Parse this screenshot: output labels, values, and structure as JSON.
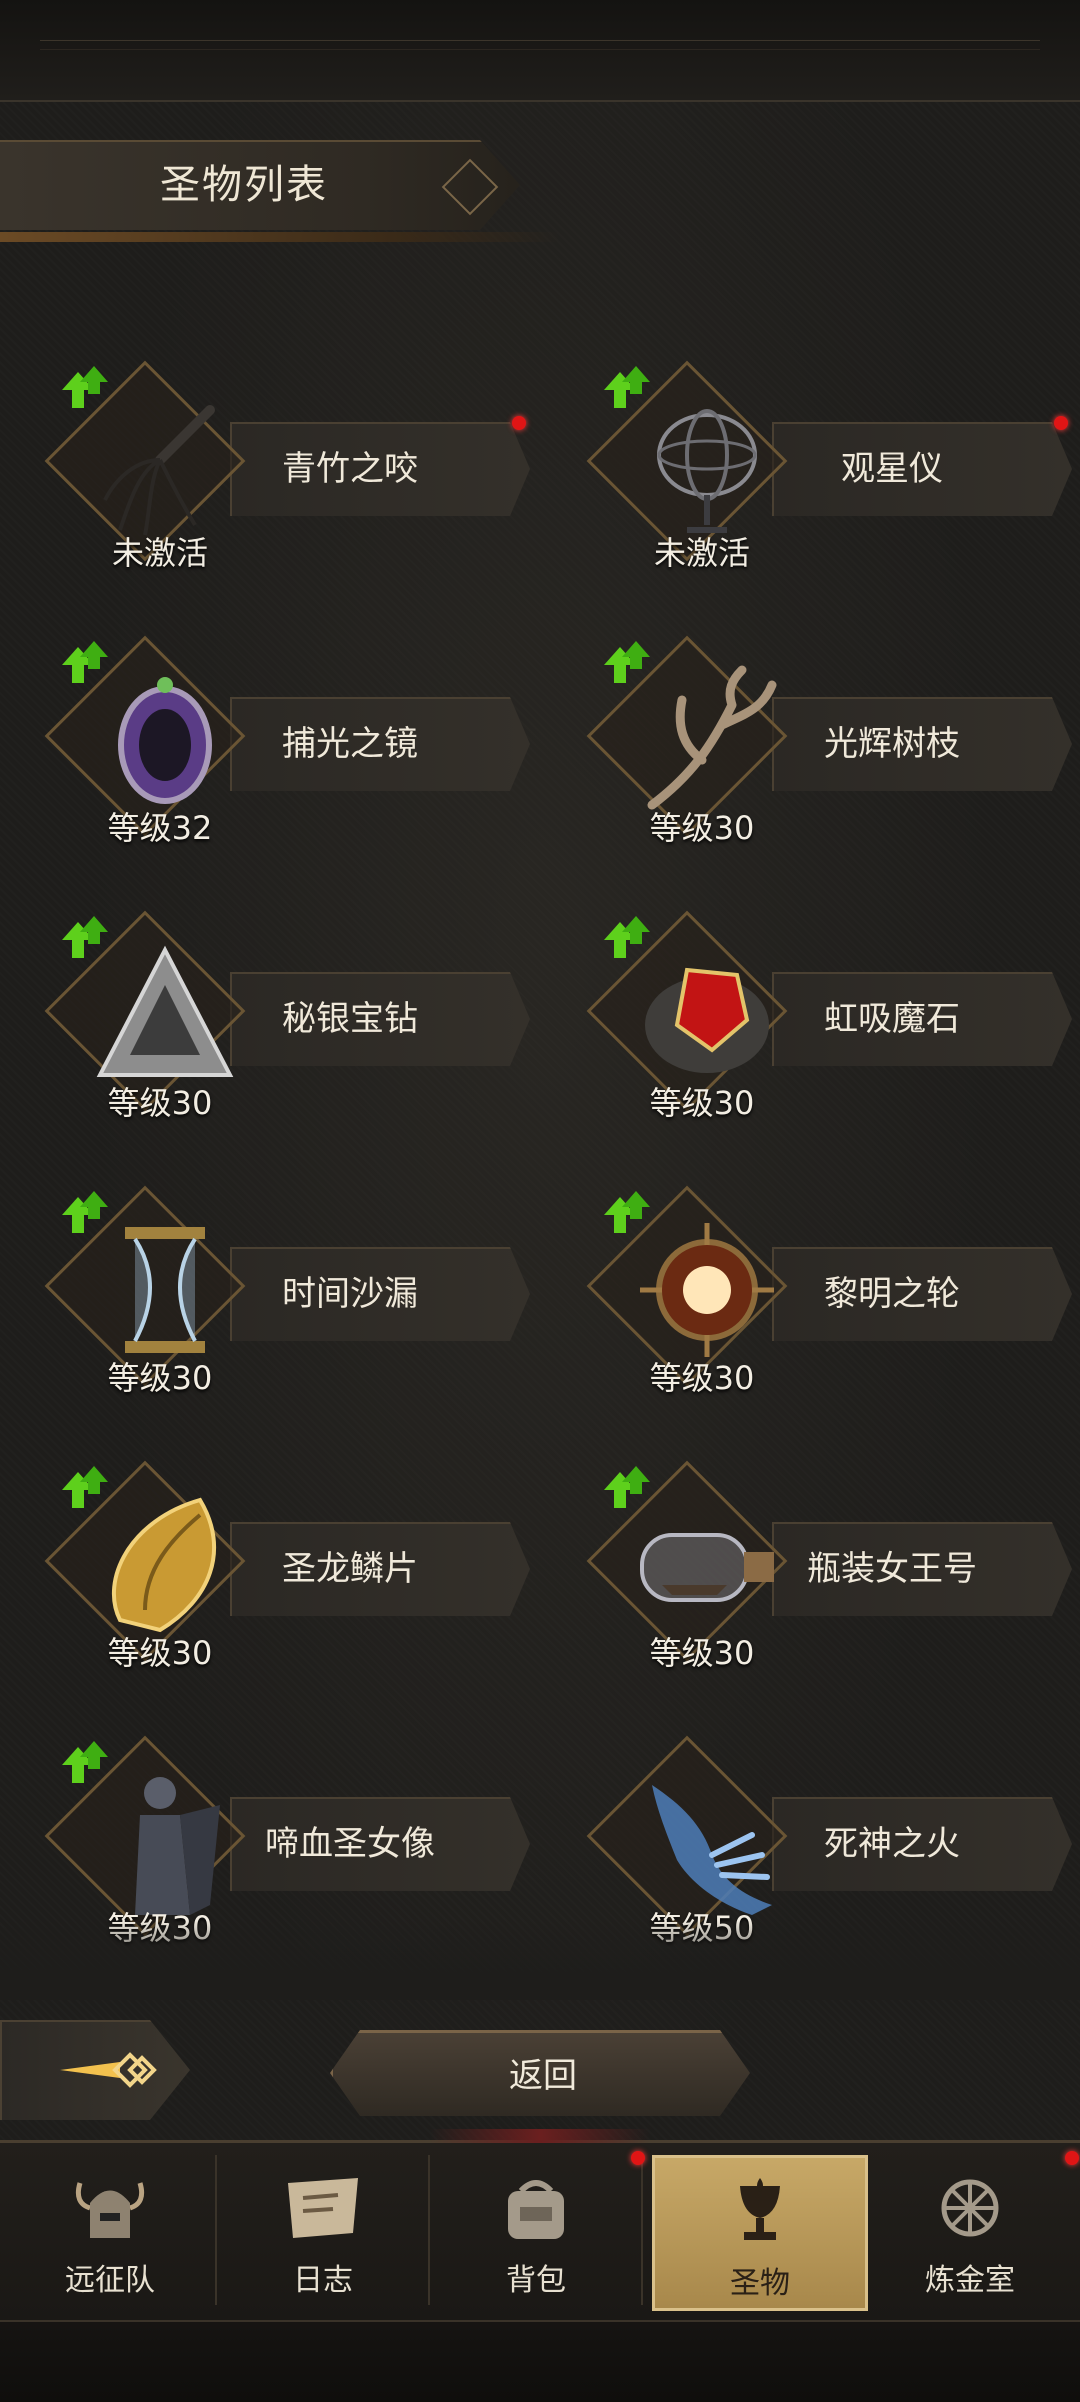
{
  "header": {
    "title": "圣物列表"
  },
  "relics": [
    {
      "name": "青竹之咬",
      "status": "未激活",
      "icon": "whip-icon",
      "has_dot": true
    },
    {
      "name": "观星仪",
      "status": "未激活",
      "icon": "armillary-icon",
      "has_dot": true
    },
    {
      "name": "捕光之镜",
      "status": "等级32",
      "icon": "mirror-icon",
      "has_dot": false
    },
    {
      "name": "光辉树枝",
      "status": "等级30",
      "icon": "branch-icon",
      "has_dot": false
    },
    {
      "name": "秘银宝钻",
      "status": "等级30",
      "icon": "pyramid-icon",
      "has_dot": false
    },
    {
      "name": "虹吸魔石",
      "status": "等级30",
      "icon": "red-stone-icon",
      "has_dot": false
    },
    {
      "name": "时间沙漏",
      "status": "等级30",
      "icon": "hourglass-icon",
      "has_dot": false
    },
    {
      "name": "黎明之轮",
      "status": "等级30",
      "icon": "sun-wheel-icon",
      "has_dot": false
    },
    {
      "name": "圣龙鳞片",
      "status": "等级30",
      "icon": "dragon-scale-icon",
      "has_dot": false
    },
    {
      "name": "瓶装女王号",
      "status": "等级30",
      "icon": "ship-bottle-icon",
      "has_dot": false
    },
    {
      "name": "啼血圣女像",
      "status": "等级30",
      "icon": "statue-icon",
      "has_dot": false
    },
    {
      "name": "死神之火",
      "status": "等级50",
      "icon": "ghost-hand-icon",
      "has_dot": false
    }
  ],
  "controls": {
    "back_label": "返回"
  },
  "nav": [
    {
      "label": "远征队",
      "icon": "helmet-icon",
      "active": false,
      "has_dot": false
    },
    {
      "label": "日志",
      "icon": "map-scroll-icon",
      "active": false,
      "has_dot": false
    },
    {
      "label": "背包",
      "icon": "backpack-icon",
      "active": false,
      "has_dot": true
    },
    {
      "label": "圣物",
      "icon": "chalice-icon",
      "active": true,
      "has_dot": false
    },
    {
      "label": "炼金室",
      "icon": "alchemy-icon",
      "active": false,
      "has_dot": true
    }
  ],
  "colors": {
    "accent_gold": "#c7a867",
    "notify_red": "#e01515",
    "upgrade_green": "#5ed01c"
  }
}
